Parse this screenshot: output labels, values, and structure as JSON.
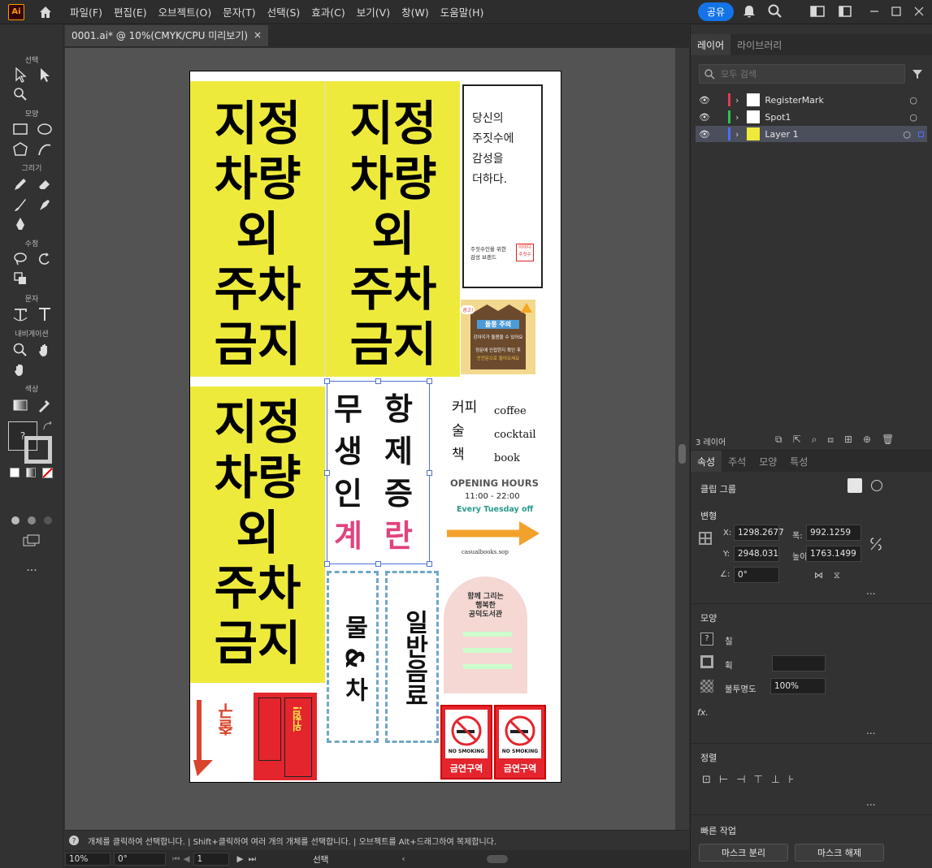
{
  "app": {
    "logo": "Ai"
  },
  "menu": [
    "파일(F)",
    "편집(E)",
    "오브젝트(O)",
    "문자(T)",
    "선택(S)",
    "효과(C)",
    "보기(V)",
    "창(W)",
    "도움말(H)"
  ],
  "share_label": "공유",
  "toolbar": {
    "sections": {
      "select": "선택",
      "shape": "모양",
      "draw": "그리기",
      "modify": "수정",
      "type": "문자",
      "navigate": "내비게이션",
      "color": "색상"
    },
    "swatch_q": "?",
    "more": "..."
  },
  "document": {
    "tab_title": "0001.ai* @ 10%(CMYK/CPU 미리보기)",
    "close": "×"
  },
  "layers_panel": {
    "tabs": [
      "레이어",
      "라이브러리"
    ],
    "search_placeholder": "모두 검색",
    "layers": [
      {
        "name": "RegisterMark",
        "color": "#e8384f"
      },
      {
        "name": "Spot1",
        "color": "#29c64a"
      },
      {
        "name": "Layer 1",
        "color": "#4f6cff"
      }
    ],
    "count": "3 레이어"
  },
  "props_panel": {
    "tabs": [
      "속성",
      "주석",
      "모양",
      "특성"
    ],
    "object_type": "클립 그룹",
    "transform_title": "변형",
    "x_label": "X:",
    "x": "1298.2677",
    "w_label": "폭:",
    "w": "992.1259",
    "y_label": "Y:",
    "y": "2948.031",
    "h_label": "높이:",
    "h": "1763.1499",
    "angle": "0°",
    "appearance_title": "모양",
    "fill_label": "칠",
    "stroke_label": "획",
    "opacity_label": "불투명도",
    "opacity": "100%",
    "fx": "fx.",
    "align_title": "정렬",
    "quick_title": "빠른 작업",
    "btn_release_mask": "마스크 분리",
    "btn_unmask": "마스크 해제",
    "more": "..."
  },
  "status": {
    "hint": "개체를 클릭하여 선택합니다.  |  Shift+클릭하여 여러 개의 개체를 선택합니다.  |  오브젝트를 Alt+드래그하여 복제합니다.",
    "zoom": "10%",
    "rotation": "0°",
    "artboard": "1",
    "mode": "선택"
  },
  "artwork": {
    "parking": [
      "지정",
      "차량",
      "외",
      "주차",
      "금지"
    ],
    "poster_text": [
      "당신의",
      "주짓수에",
      "감성을",
      "더하다."
    ],
    "poster_brand": "주짓수인을 위한\n감성 브랜드",
    "poster_logo": "아이디\n주짓수",
    "warn_top": "경고!",
    "warn_title": "돌풍 주의",
    "warn_line1": "강아지가 돌봄을 수 있어요",
    "warn_line2": "정문에 인접한지 확인 후",
    "warn_line3": "안전문으로 들어오세요",
    "eggs": [
      [
        "무",
        "항"
      ],
      [
        "생",
        "제"
      ],
      [
        "인",
        "증"
      ],
      [
        "계",
        "란"
      ]
    ],
    "menu_words": [
      [
        "커피",
        "coffee"
      ],
      [
        "술",
        "cocktail"
      ],
      [
        "책",
        "book"
      ]
    ],
    "opening": "OPENING HOURS",
    "hours": "11:00 - 22:00",
    "off": "Every Tuesday off",
    "insta": "casualbooks.sop",
    "banner1": "물 & 차",
    "banner2": "일반음료",
    "arch_title": "함께 그리는\n행복한\n공덕도서관",
    "nosmoke_en": "NO SMOKING",
    "nosmoke_ko": "금연구역",
    "exit": "출구",
    "danger": "위험!"
  }
}
